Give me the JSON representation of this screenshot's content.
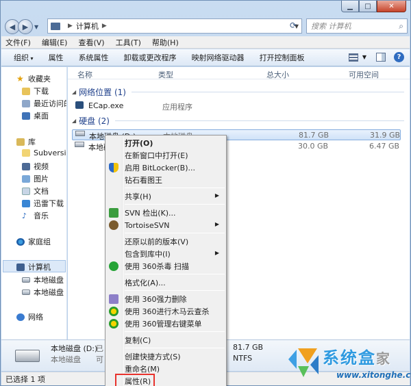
{
  "address": {
    "segment": "计算机",
    "search_placeholder": "搜索 计算机"
  },
  "menubar": [
    "文件(F)",
    "编辑(E)",
    "查看(V)",
    "工具(T)",
    "帮助(H)"
  ],
  "commands": {
    "organize": "组织",
    "items": [
      "属性",
      "系统属性",
      "卸载或更改程序",
      "映射网络驱动器",
      "打开控制面板"
    ]
  },
  "nav": {
    "favorites": "收藏夹",
    "fav_items": [
      "下载",
      "最近访问的",
      "桌面"
    ],
    "library": "库",
    "lib_items": [
      "Subversion",
      "视频",
      "图片",
      "文档",
      "迅雷下载",
      "音乐"
    ],
    "homegroup": "家庭组",
    "computer": "计算机",
    "drives": [
      "本地磁盘 (C",
      "本地磁盘 (D"
    ],
    "network": "网络"
  },
  "columns": {
    "name": "名称",
    "type": "类型",
    "total": "总大小",
    "free": "可用空间"
  },
  "groups": {
    "network_location": "网络位置 (1)",
    "hard_disks": "硬盘 (2)"
  },
  "rows": {
    "ecap": {
      "name": "ECap.exe",
      "type": "应用程序"
    },
    "disk_d": {
      "name": "本地磁盘 (D:)",
      "type": "本地磁盘",
      "total": "81.7 GB",
      "free": "31.9 GB"
    },
    "disk_c": {
      "name": "本地磁",
      "total": "30.0 GB",
      "free": "6.47 GB"
    }
  },
  "details": {
    "name": "本地磁盘 (D:)",
    "type": "本地磁盘",
    "used_label": "已",
    "avail_label": "可",
    "total": "81.7 GB",
    "fs": "NTFS"
  },
  "status": "已选择 1 项",
  "context_menu": {
    "open": "打开(O)",
    "open_new": "在新窗口中打开(E)",
    "bitlocker": "启用 BitLocker(B)...",
    "diamond": "钻石看图王",
    "share": "共享(H)",
    "svn_checkout": "SVN 检出(K)...",
    "tortoise": "TortoiseSVN",
    "restore": "还原以前的版本(V)",
    "include_lib": "包含到库中(I)",
    "scan360": "使用 360杀毒 扫描",
    "format": "格式化(A)...",
    "force_delete": "使用 360强力删除",
    "trojan_cloud": "使用 360进行木马云查杀",
    "manage_menu": "使用 360管理右键菜单",
    "copy": "复制(C)",
    "shortcut": "创建快捷方式(S)",
    "rename": "重命名(M)",
    "properties": "属性(R)"
  },
  "watermark": {
    "title": "系统盒",
    "title_suffix": "家",
    "url": "www.xitonghe.com"
  },
  "colors": {
    "highlight_box": "#e8322c",
    "group_text": "#1e3f8a"
  }
}
